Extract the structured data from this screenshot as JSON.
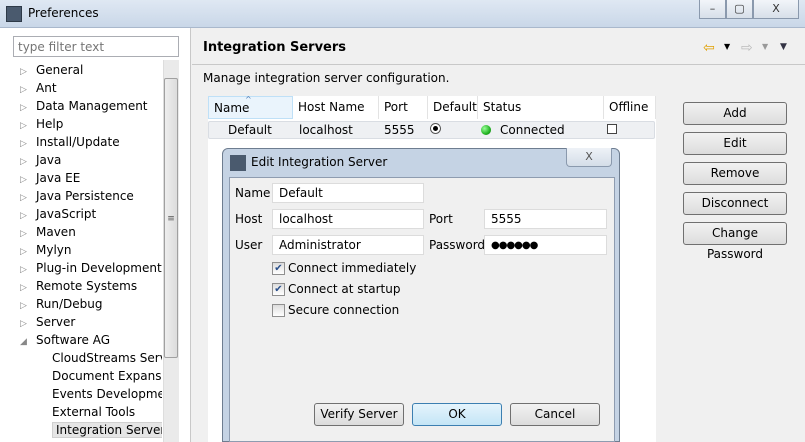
{
  "window": {
    "title": "Preferences",
    "controls": [
      "–",
      "▢",
      "X"
    ]
  },
  "filter": {
    "placeholder": "type filter text"
  },
  "tree": [
    {
      "label": "General",
      "expanded": false
    },
    {
      "label": "Ant",
      "expanded": false
    },
    {
      "label": "Data Management",
      "expanded": false
    },
    {
      "label": "Help",
      "expanded": false
    },
    {
      "label": "Install/Update",
      "expanded": false
    },
    {
      "label": "Java",
      "expanded": false
    },
    {
      "label": "Java EE",
      "expanded": false
    },
    {
      "label": "Java Persistence",
      "expanded": false
    },
    {
      "label": "JavaScript",
      "expanded": false
    },
    {
      "label": "Maven",
      "expanded": false
    },
    {
      "label": "Mylyn",
      "expanded": false
    },
    {
      "label": "Plug-in Development",
      "expanded": false
    },
    {
      "label": "Remote Systems",
      "expanded": false
    },
    {
      "label": "Run/Debug",
      "expanded": false
    },
    {
      "label": "Server",
      "expanded": false
    },
    {
      "label": "Software AG",
      "expanded": true
    },
    {
      "label": "CloudStreams Server",
      "child": true
    },
    {
      "label": "Document Expansion",
      "child": true
    },
    {
      "label": "Events Development",
      "child": true
    },
    {
      "label": "External Tools",
      "child": true
    },
    {
      "label": "Integration Servers",
      "child": true,
      "selected": true
    }
  ],
  "page": {
    "title": "Integration Servers",
    "description": "Manage integration server configuration."
  },
  "table": {
    "columns": [
      "Name",
      "Host Name ...",
      "Port",
      "Default",
      "Status",
      "Offline"
    ],
    "rows": [
      {
        "name": "Default",
        "host": "localhost",
        "port": "5555",
        "default": true,
        "status": "Connected",
        "offline": false
      }
    ]
  },
  "buttons": {
    "add": "Add",
    "edit": "Edit",
    "remove": "Remove",
    "disconnect": "Disconnect",
    "change_password": "Change Password"
  },
  "dialog": {
    "title": "Edit Integration Server",
    "close": "X",
    "name_label": "Name",
    "name": "Default",
    "host_label": "Host",
    "host": "localhost",
    "port_label": "Port",
    "port": "5555",
    "user_label": "User",
    "user": "Administrator",
    "password_label": "Password",
    "password": "●●●●●●",
    "connect_immediately": "Connect immediately",
    "connect_startup": "Connect at startup",
    "secure": "Secure connection",
    "verify": "Verify Server",
    "ok": "OK",
    "cancel": "Cancel"
  },
  "colors": {
    "status_connected": "#22b322",
    "accent": "#3399ff"
  }
}
